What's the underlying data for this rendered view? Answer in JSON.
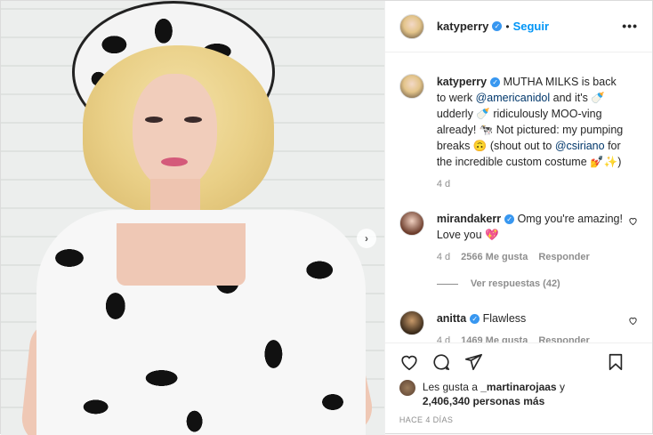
{
  "header": {
    "username": "katyperry",
    "verified_mark": "✓",
    "separator": "•",
    "follow_label": "Seguir",
    "more_label": "•••"
  },
  "photo": {
    "next_label": "›"
  },
  "caption": {
    "username": "katyperry",
    "text_1": " MUTHA MILKS is back to werk ",
    "mention_1": "@americanidol",
    "text_2": " and it's 🍼udderly 🍼 ridiculously MOO-ving already! 🐄 Not pictured: my pumping breaks 🙃 (shout out to ",
    "mention_2": "@csiriano",
    "text_3": " for the incredible custom costume 💅✨)",
    "time": "4 d"
  },
  "comments": [
    {
      "username": "mirandakerr",
      "text": " Omg you're amazing! Love you 💖",
      "time": "4 d",
      "likes": "2566 Me gusta",
      "reply": "Responder",
      "view_replies": "Ver respuestas (42)"
    },
    {
      "username": "anitta",
      "text": " Flawless",
      "time": "4 d",
      "likes": "1469 Me gusta",
      "reply": "Responder"
    }
  ],
  "likes": {
    "prefix": "Les gusta a ",
    "user": "_martinarojaas",
    "mid": " y ",
    "count": "2,406,340 personas más"
  },
  "date_label": "HACE 4 DÍAS",
  "icons": {
    "heart": "heart-icon",
    "comment": "comment-icon",
    "share": "share-icon",
    "bookmark": "bookmark-icon"
  },
  "colors": {
    "accent": "#0095f6",
    "verified": "#3897f0",
    "mention": "#00376b",
    "muted": "#8e8e8e"
  }
}
